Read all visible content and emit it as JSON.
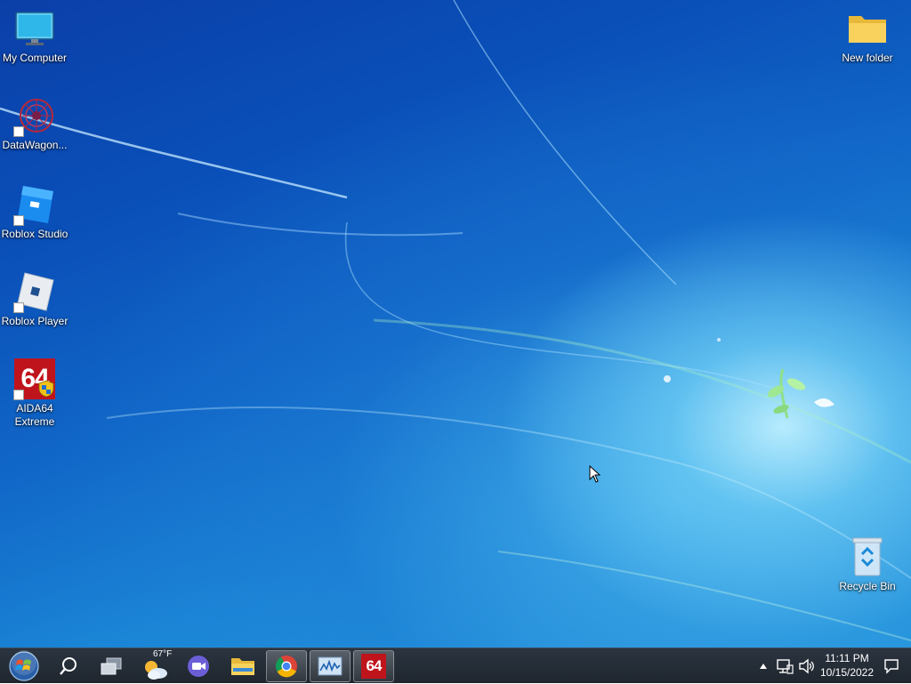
{
  "desktop": {
    "icons": [
      {
        "label": "My Computer",
        "icon": "monitor-icon"
      },
      {
        "label": "DataWagon...",
        "icon": "datawagon-icon"
      },
      {
        "label": "Roblox Studio",
        "icon": "roblox-studio-icon"
      },
      {
        "label": "Roblox Player",
        "icon": "roblox-player-icon"
      },
      {
        "label": "AIDA64 Extreme",
        "icon": "aida64-icon",
        "glyph_text": "64"
      },
      {
        "label": "New folder",
        "icon": "folder-icon"
      },
      {
        "label": "Recycle Bin",
        "icon": "recycle-bin-icon"
      }
    ]
  },
  "taskbar": {
    "start": {
      "icon": "windows-start-orb-icon"
    },
    "search": {
      "icon": "search-icon"
    },
    "task_view": {
      "icon": "task-view-icon"
    },
    "weather": {
      "temperature": "67°F",
      "icon": "partly-cloudy-icon"
    },
    "meet": {
      "icon": "video-call-icon"
    },
    "pinned": [
      {
        "name": "File Explorer",
        "icon": "file-explorer-icon",
        "active": false
      },
      {
        "name": "Google Chrome",
        "icon": "chrome-icon",
        "active": true
      },
      {
        "name": "Resource Monitor",
        "icon": "monitor-chart-icon",
        "active": true
      },
      {
        "name": "AIDA64",
        "icon": "aida64-icon",
        "glyph_text": "64",
        "active": true
      }
    ],
    "tray": {
      "overflow_icon": "chevron-up-icon",
      "network_icon": "network-icon",
      "volume_icon": "speaker-icon",
      "notifications_icon": "notification-icon"
    },
    "clock": {
      "time": "11:11 PM",
      "date": "10/15/2022"
    }
  },
  "colors": {
    "taskbar_bg": "#222a33",
    "desktop_top": "#0b3fa8",
    "desktop_glow": "#bff0ff",
    "aida_red": "#c0141c"
  }
}
